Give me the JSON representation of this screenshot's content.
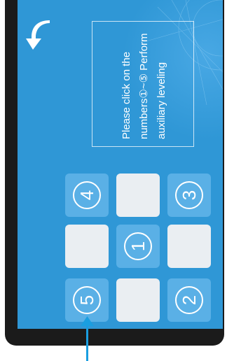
{
  "instruction": {
    "lines": [
      "Please click on the",
      "numbers①~⑤ Perform",
      "auxiliary leveling"
    ]
  },
  "tiles": {
    "top_left": "4",
    "top_right": "3",
    "center": "1",
    "bottom_left": "5",
    "bottom_right": "2"
  },
  "colors": {
    "screen": "#2f97d6",
    "number_tile": "#5ab0e6",
    "blank_tile": "#eaeef2",
    "bezel": "#1b1b1b",
    "pointer": "#1a9ee0"
  },
  "icons": {
    "back": "curved-back-arrow-icon",
    "pointer": "arrow-up-icon"
  }
}
